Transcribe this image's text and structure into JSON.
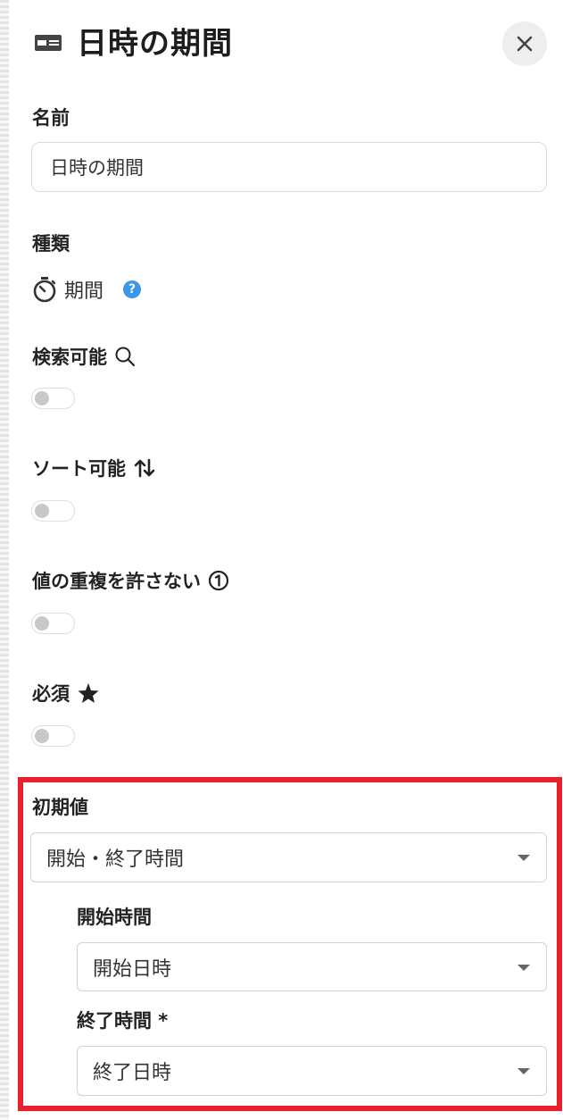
{
  "header": {
    "title": "日時の期間",
    "icon": "id-card-icon",
    "close_icon": "close-icon"
  },
  "name_field": {
    "label": "名前",
    "value": "日時の期間"
  },
  "type_field": {
    "label": "種類",
    "value": "期間",
    "icon": "stopwatch-icon",
    "help_icon": "question-circle-icon",
    "help_glyph": "?"
  },
  "searchable": {
    "label": "検索可能",
    "icon": "search-icon",
    "enabled": false
  },
  "sortable": {
    "label": "ソート可能",
    "icon": "sort-arrows-icon",
    "enabled": false
  },
  "unique": {
    "label": "値の重複を許さない",
    "icon": "number-one-circle-icon",
    "enabled": false
  },
  "required": {
    "label": "必須",
    "icon": "star-icon",
    "enabled": false
  },
  "initial_value": {
    "label": "初期値",
    "selected": "開始・終了時間",
    "start": {
      "label": "開始時間",
      "selected": "開始日時"
    },
    "end": {
      "label": "終了時間 *",
      "selected": "終了日時"
    }
  },
  "colors": {
    "highlight": "#e8202a",
    "help": "#3b97e8",
    "toggle_off": "#c8c8c8"
  }
}
